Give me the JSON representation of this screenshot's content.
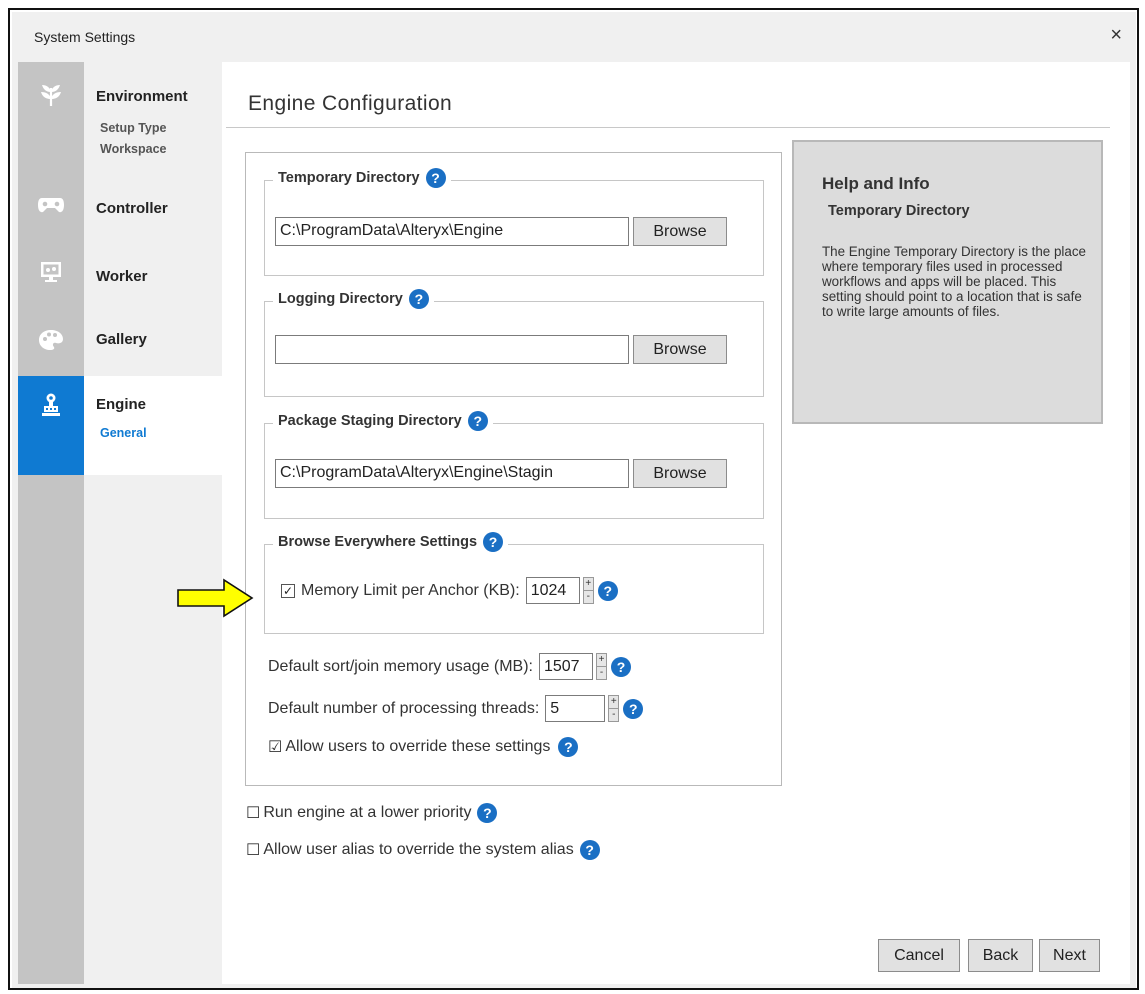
{
  "window": {
    "title": "System Settings",
    "close_glyph": "×"
  },
  "rail": {
    "icons": [
      "leaf-icon",
      "gamepad-icon",
      "monitor-icon",
      "palette-icon",
      "engine-icon"
    ],
    "active_index": 4,
    "accent_color": "#0f7ad2"
  },
  "nav": {
    "environment": {
      "label": "Environment",
      "subs": [
        "Setup Type",
        "Workspace"
      ]
    },
    "controller": {
      "label": "Controller"
    },
    "worker": {
      "label": "Worker"
    },
    "gallery": {
      "label": "Gallery"
    },
    "engine": {
      "label": "Engine",
      "subs": [
        "General"
      ]
    }
  },
  "page": {
    "title": "Engine Configuration"
  },
  "temp_dir": {
    "legend": "Temporary Directory",
    "value": "C:\\ProgramData\\Alteryx\\Engine",
    "browse": "Browse"
  },
  "log_dir": {
    "legend": "Logging Directory",
    "value": "",
    "browse": "Browse"
  },
  "staging_dir": {
    "legend": "Package Staging Directory",
    "value": "C:\\ProgramData\\Alteryx\\Engine\\Stagin",
    "browse": "Browse"
  },
  "browse_everywhere": {
    "legend": "Browse Everywhere Settings",
    "memory_label": "Memory Limit per Anchor (KB):",
    "memory_checked": true,
    "memory_value": "1024"
  },
  "sort_join": {
    "label": "Default sort/join memory usage (MB):",
    "value": "1507"
  },
  "threads": {
    "label": "Default number of processing threads:",
    "value": "5"
  },
  "allow_override": {
    "label": "Allow users to override these settings",
    "checked": true
  },
  "low_priority": {
    "label": "Run engine at a lower priority",
    "checked": false
  },
  "alias_override": {
    "label": "Allow user alias to override the system alias",
    "checked": false
  },
  "help": {
    "title": "Help and Info",
    "subtitle": "Temporary Directory",
    "body": "The Engine Temporary Directory is the place where temporary files used in processed workflows and apps will be placed. This setting should point to a location that is safe to write large amounts of files."
  },
  "footer": {
    "cancel": "Cancel",
    "back": "Back",
    "next": "Next"
  },
  "spinner": {
    "up": "+",
    "down": "-"
  },
  "help_glyph": "?",
  "check_glyph": "☑",
  "uncheck_glyph": "☐",
  "annotation": {
    "arrow_color": "#ffff00"
  }
}
